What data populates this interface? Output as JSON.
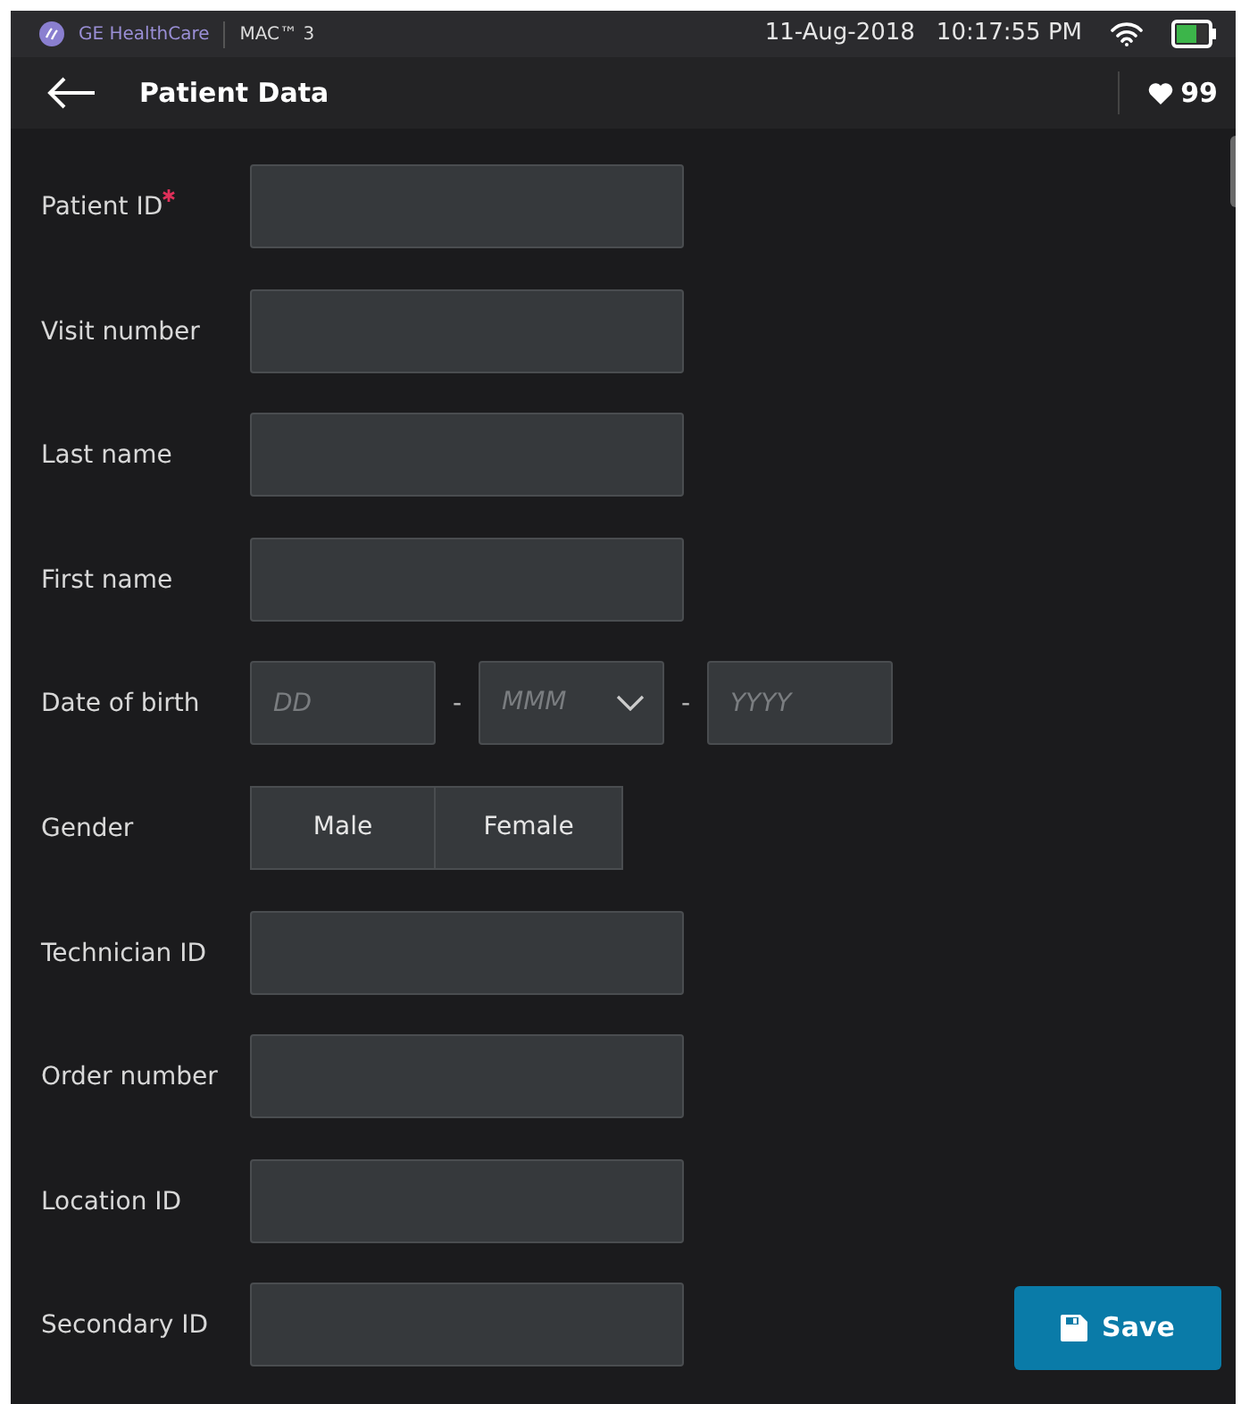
{
  "status_bar": {
    "brand": "GE HealthCare",
    "product": "MAC™ 3",
    "date": "11-Aug-2018",
    "time": "10:17:55 PM"
  },
  "header": {
    "title": "Patient Data",
    "heart_rate": "99"
  },
  "fields": [
    {
      "kind": "text",
      "label": "Patient ID",
      "required": true
    },
    {
      "kind": "text",
      "label": "Visit number",
      "required": false
    },
    {
      "kind": "text",
      "label": "Last name",
      "required": false
    },
    {
      "kind": "text",
      "label": "First name",
      "required": false
    },
    {
      "kind": "date",
      "label": "Date of birth",
      "day": {
        "placeholder": "DD"
      },
      "month": {
        "placeholder": "MMM"
      },
      "year": {
        "placeholder": "YYYY"
      },
      "separators": [
        "-",
        "-"
      ]
    },
    {
      "kind": "choice",
      "label": "Gender",
      "options": [
        {
          "label": "Male",
          "selected": false
        },
        {
          "label": "Female",
          "selected": false
        }
      ]
    },
    {
      "kind": "text",
      "label": "Technician ID",
      "required": false
    },
    {
      "kind": "text",
      "label": "Order number",
      "required": false
    },
    {
      "kind": "text",
      "label": "Location ID",
      "required": false
    },
    {
      "kind": "text",
      "label": "Secondary ID",
      "required": false
    }
  ],
  "save_button": {
    "label": "Save"
  }
}
